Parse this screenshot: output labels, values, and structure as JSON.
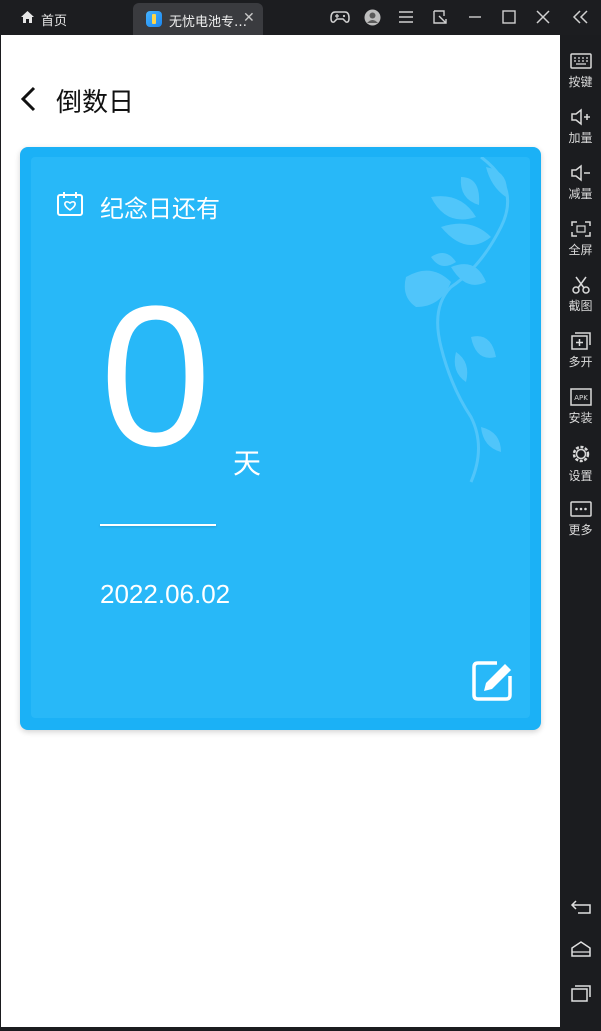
{
  "window": {
    "home_tab_label": "首页",
    "app_tab_label": "无忧电池专…",
    "icons": [
      "gamepad-icon",
      "avatar-icon",
      "menu-icon",
      "popout-icon",
      "minimize-icon",
      "maximize-icon",
      "close-icon",
      "collapse-icon"
    ]
  },
  "page": {
    "title": "倒数日"
  },
  "card": {
    "heading": "纪念日还有",
    "days": "0",
    "unit": "天",
    "date": "2022.06.02",
    "colors": {
      "outer": "#1bb1f6",
      "inner": "#28b8f8",
      "text": "#ffffff"
    }
  },
  "sidebar": {
    "items": [
      {
        "label": "按键",
        "icon": "keyboard-icon"
      },
      {
        "label": "加量",
        "icon": "volume-up-icon"
      },
      {
        "label": "减量",
        "icon": "volume-down-icon"
      },
      {
        "label": "全屏",
        "icon": "fullscreen-icon"
      },
      {
        "label": "截图",
        "icon": "scissors-icon"
      },
      {
        "label": "多开",
        "icon": "multi-instance-icon"
      },
      {
        "label": "安装",
        "icon": "apk-icon"
      },
      {
        "label": "设置",
        "icon": "settings-icon"
      },
      {
        "label": "更多",
        "icon": "more-icon"
      }
    ],
    "nav": [
      "back-icon",
      "home-icon",
      "recents-icon"
    ]
  }
}
